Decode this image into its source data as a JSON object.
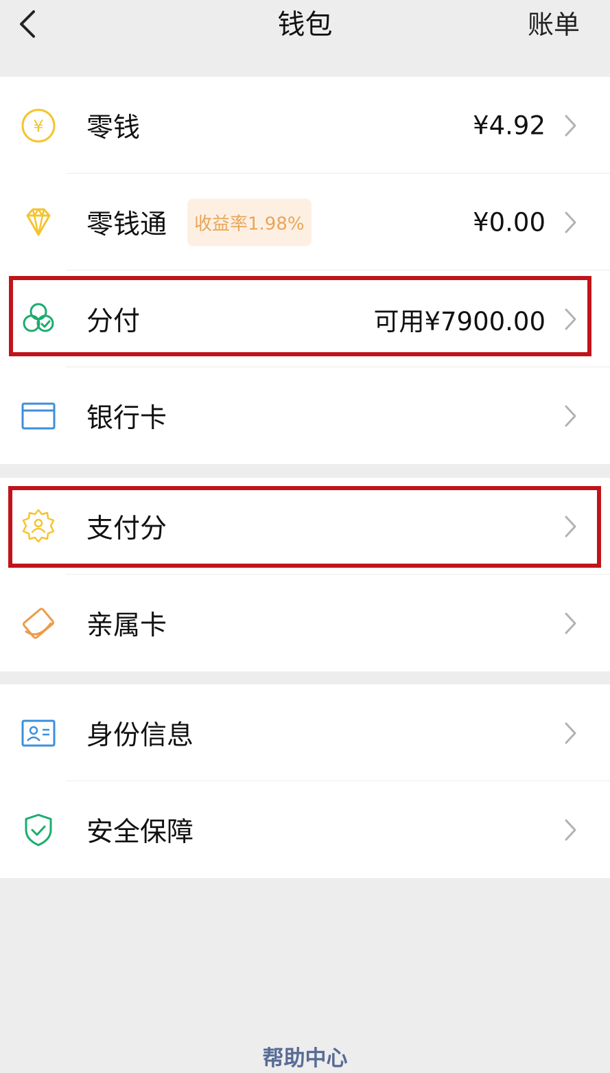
{
  "nav": {
    "title": "钱包",
    "right_label": "账单",
    "back_icon": "chevron-left-icon"
  },
  "group1": {
    "items": [
      {
        "label": "零钱",
        "value": "¥4.92",
        "icon": "yuan-coin-icon"
      },
      {
        "label": "零钱通",
        "badge": "收益率1.98%",
        "value": "¥0.00",
        "icon": "diamond-icon"
      },
      {
        "label": "分付",
        "value": "可用¥7900.00",
        "icon": "fenfu-circles-icon"
      },
      {
        "label": "银行卡",
        "value": "",
        "icon": "bank-card-icon"
      }
    ]
  },
  "group2": {
    "items": [
      {
        "label": "支付分",
        "value": "",
        "icon": "payment-score-badge-icon"
      },
      {
        "label": "亲属卡",
        "value": "",
        "icon": "family-card-icon"
      }
    ]
  },
  "group3": {
    "items": [
      {
        "label": "身份信息",
        "value": "",
        "icon": "id-card-icon"
      },
      {
        "label": "安全保障",
        "value": "",
        "icon": "shield-check-icon"
      }
    ]
  },
  "footer": {
    "help_label": "帮助中心"
  },
  "colors": {
    "background": "#ededed",
    "highlight": "#c0141a",
    "link": "#576b95",
    "badge_text": "#e9a559",
    "badge_bg": "#fdf0e2",
    "coin": "#f4c42f",
    "fenfu": "#1aad6c",
    "card": "#3c8fdb",
    "family": "#ec9b4a",
    "shield": "#1aad6c"
  }
}
